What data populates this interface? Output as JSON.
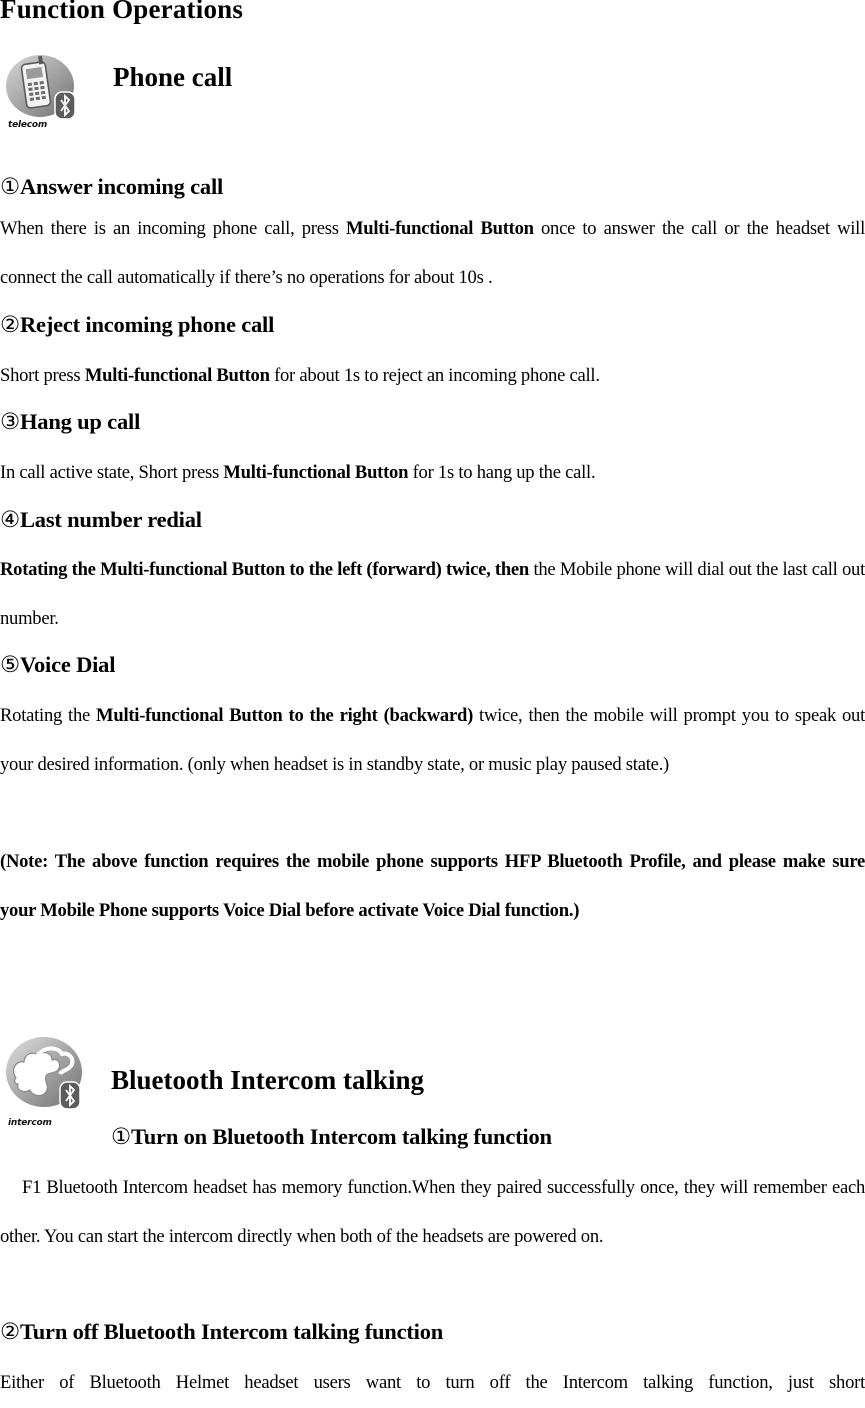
{
  "page_title": "Function Operations",
  "sections": [
    {
      "title": "Phone call",
      "icon": {
        "name": "telecom-icon",
        "label": "telecom"
      },
      "items": [
        {
          "number": "①",
          "heading": "Answer incoming call",
          "text": {
            "pre": "When there is an incoming phone call, press ",
            "bold": "Multi-functional Button",
            "post": " once to answer the call or the headset will connect the call automatically if there’s no operations for about 10s ."
          }
        },
        {
          "number": "②",
          "heading": "Reject incoming phone call",
          "text": {
            "pre": "Short press ",
            "bold": "Multi-functional Button",
            "post": " for about 1s to reject an incoming phone call."
          }
        },
        {
          "number": "③",
          "heading": "Hang up call",
          "text": {
            "pre": "In call active state, Short press ",
            "bold": "Multi-functional Button",
            "post": " for 1s to hang up the call."
          }
        },
        {
          "number": "④",
          "heading": "Last number redial",
          "text": {
            "pre": "",
            "bold": "Rotating the Multi-functional Button to the left (forward) twice, then",
            "post": " the Mobile phone will dial out the last call out number."
          }
        },
        {
          "number": "⑤",
          "heading": "Voice Dial",
          "text": {
            "pre": "Rotating the ",
            "bold": "Multi-functional Button to the right (backward)",
            "post": " twice, then the mobile will prompt you to speak out your desired information. (only when headset is in standby state, or music play paused state.)"
          },
          "note": "(Note: The above function requires the mobile phone supports HFP Bluetooth Profile, and please make sure your Mobile Phone supports Voice Dial before activate Voice Dial function.)"
        }
      ]
    },
    {
      "title": "Bluetooth Intercom talking",
      "icon": {
        "name": "intercom-icon",
        "label": "intercom"
      },
      "items": [
        {
          "number": "①",
          "heading": "Turn on Bluetooth Intercom talking function",
          "text": "F1 Bluetooth Intercom headset has memory function.When they paired successfully once, they will remember each other. You can start the intercom directly when both of the headsets are powered on."
        },
        {
          "number": "②",
          "heading": "Turn off Bluetooth Intercom talking function",
          "text": "Either of Bluetooth Helmet headset users want to turn off the Intercom talking function, just short"
        }
      ]
    }
  ]
}
